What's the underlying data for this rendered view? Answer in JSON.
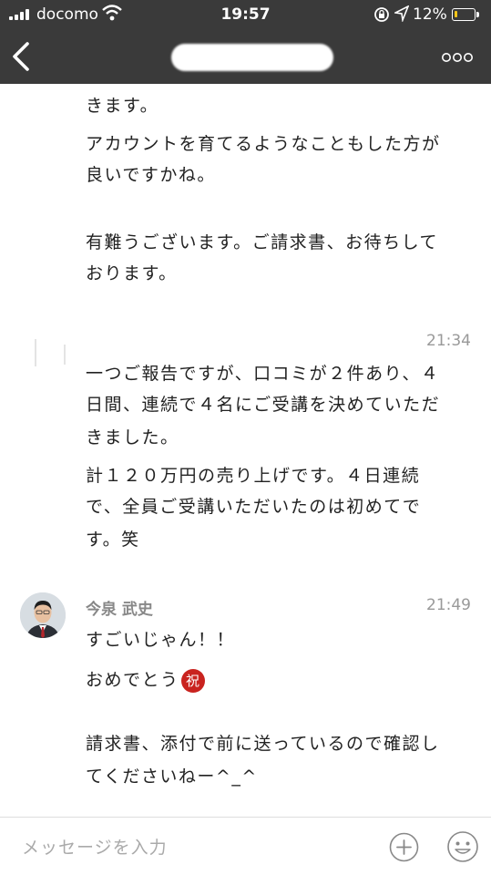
{
  "status_bar": {
    "carrier": "docomo",
    "time": "19:57",
    "battery_percent": "12%",
    "battery_level": 0.12,
    "battery_color": "#f5c518"
  },
  "nav": {
    "back_icon": "chevron-left-icon",
    "more_icon": "more-horizontal-icon"
  },
  "messages": {
    "m1": {
      "lines": [
        "きます。",
        "アカウントを育てるようなこともした方が",
        "良いですかね。"
      ]
    },
    "m2": {
      "lines": [
        "有難うございます。ご請求書、お待ちして",
        "おります。"
      ]
    },
    "m3": {
      "time": "21:34",
      "lines": [
        "一つご報告ですが、口コミが２件あり、４",
        "日間、連続で４名にご受講を決めていただ",
        "きました。",
        "計１２０万円の売り上げです。４日連続",
        "で、全員ご受講いただいたのは初めてで",
        "す。笑"
      ]
    },
    "m4": {
      "sender": "今泉 武史",
      "time": "21:49",
      "lines": [
        "すごいじゃん！！",
        "おめでとう",
        "請求書、添付で前に送っているので確認し",
        "てくださいねー^_^"
      ],
      "emoji": "祝"
    }
  },
  "input": {
    "placeholder": "メッセージを入力",
    "plus_icon": "plus-circle-icon",
    "emoji_icon": "smiley-icon"
  }
}
